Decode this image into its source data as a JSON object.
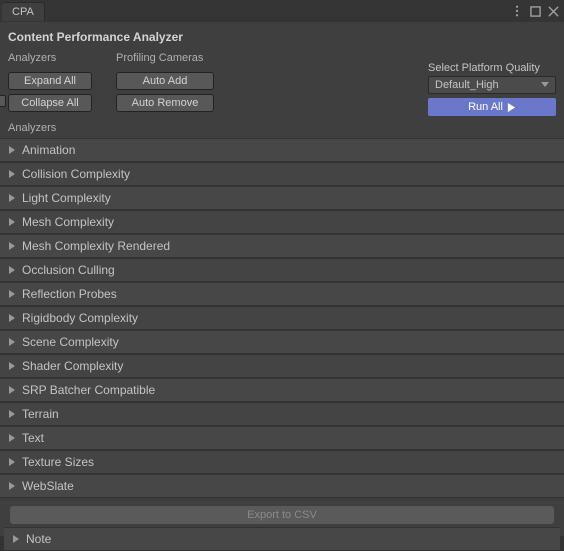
{
  "tab_title": "CPA",
  "header": "Content Performance Analyzer",
  "sections": {
    "analyzers_label": "Analyzers",
    "cameras_label": "Profiling Cameras"
  },
  "buttons": {
    "expand_all": "Expand All",
    "collapse_all": "Collapse All",
    "auto_add": "Auto Add",
    "auto_remove": "Auto Remove",
    "run_all": "Run All",
    "export_csv": "Export to CSV"
  },
  "quality": {
    "label": "Select Platform Quality",
    "selected": "Default_High"
  },
  "list_header": "Analyzers",
  "analyzers": [
    "Animation",
    "Collision Complexity",
    "Light Complexity",
    "Mesh Complexity",
    "Mesh Complexity Rendered",
    "Occlusion Culling",
    "Reflection Probes",
    "Rigidbody Complexity",
    "Scene Complexity",
    "Shader Complexity",
    "SRP Batcher Compatible",
    "Terrain",
    "Text",
    "Texture Sizes",
    "WebSlate"
  ],
  "note_label": "Note"
}
